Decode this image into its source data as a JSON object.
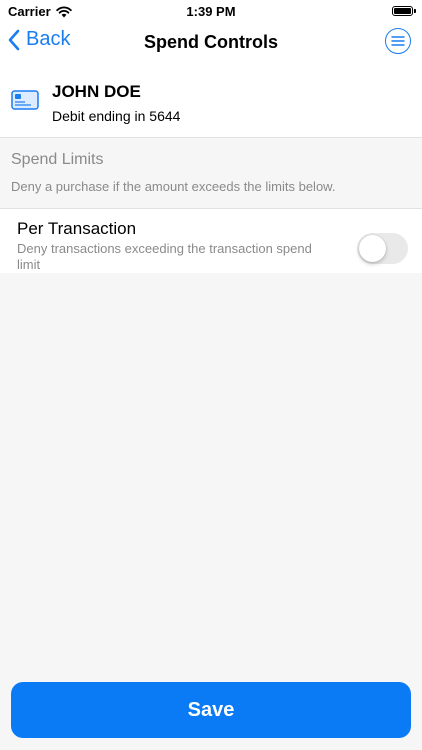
{
  "status_bar": {
    "carrier": "Carrier",
    "time": "1:39 PM",
    "icons": [
      "wifi-icon",
      "battery-icon"
    ]
  },
  "nav": {
    "back_label": "Back",
    "title": "Spend Controls",
    "back_icon": "chevron-left-icon",
    "menu_icon": "menu-icon"
  },
  "card": {
    "icon": "credit-card-icon",
    "name": "JOHN DOE",
    "subtitle": "Debit ending in 5644"
  },
  "spend_limits": {
    "title": "Spend Limits",
    "description": "Deny a purchase if the amount exceeds the limits below."
  },
  "per_transaction": {
    "title": "Per Transaction",
    "description": "Deny transactions exceeding the transaction spend limit",
    "enabled": false
  },
  "footer": {
    "save_label": "Save"
  },
  "colors": {
    "accent": "#0a7af5",
    "background": "#f6f6f6",
    "secondary_text": "#8a8a8a"
  }
}
